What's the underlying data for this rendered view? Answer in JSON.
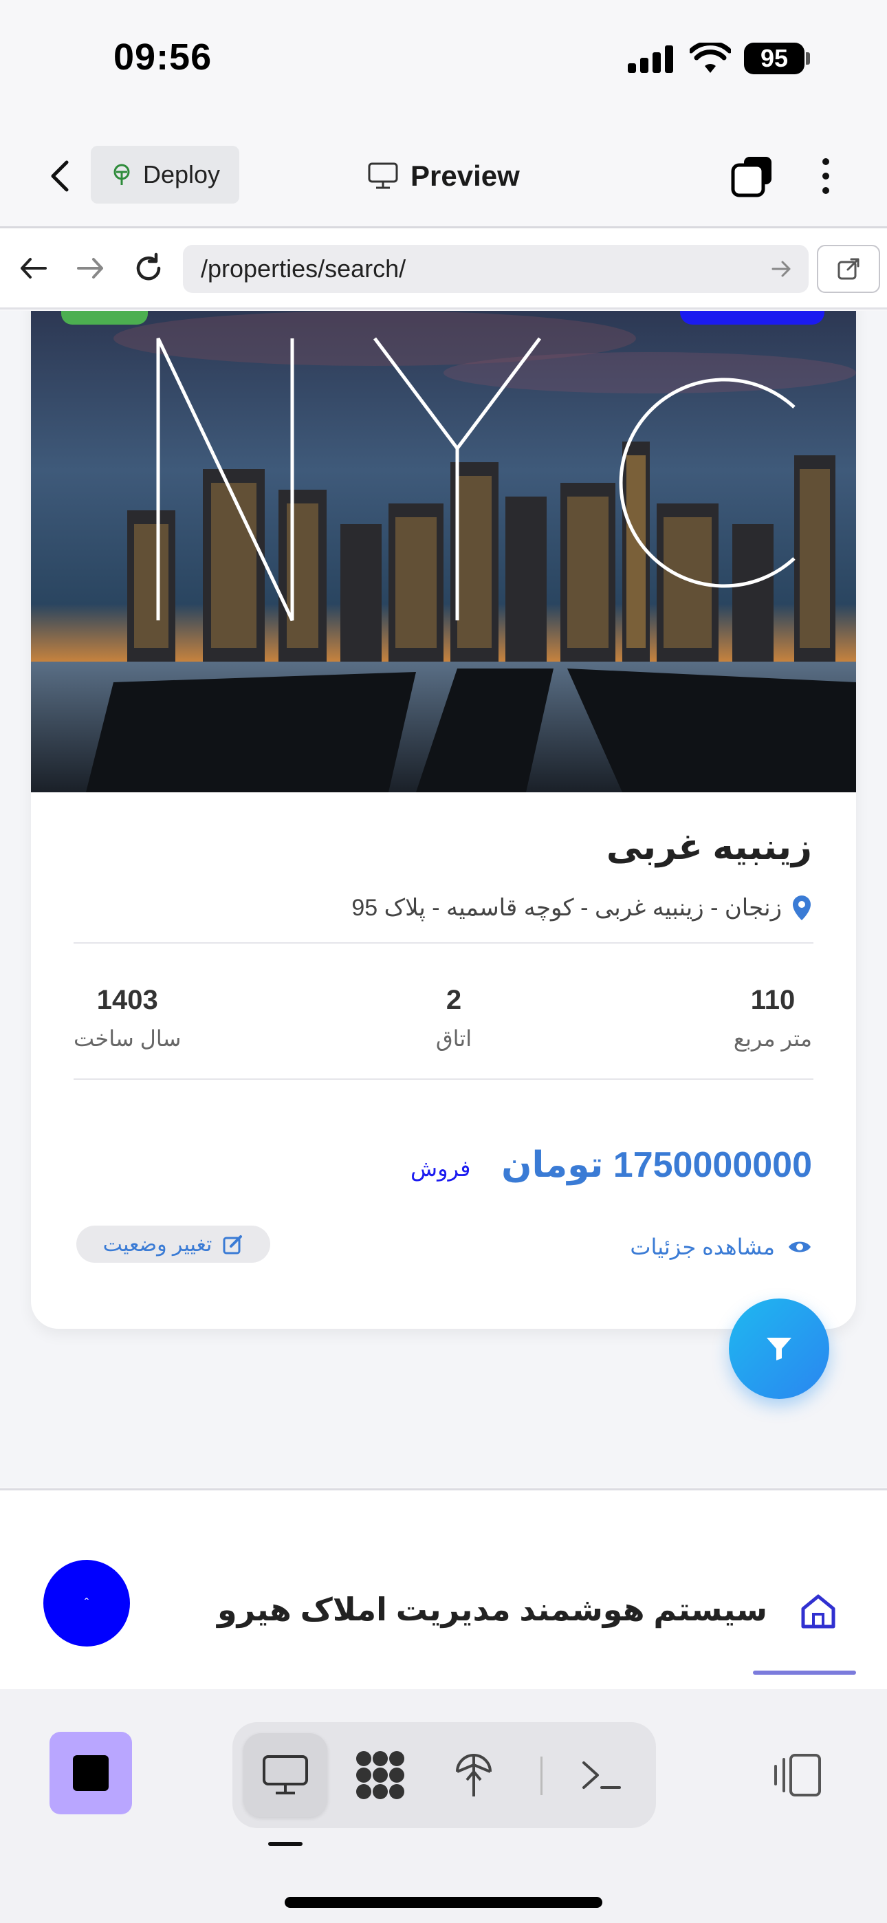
{
  "status_bar": {
    "time": "09:56",
    "battery": "95"
  },
  "topbar": {
    "deploy_label": "Deploy",
    "preview_label": "Preview"
  },
  "browser": {
    "url": "/properties/search/"
  },
  "property": {
    "photo_caption": "NYC",
    "title": "زینبیه غربی",
    "address": "زنجان - زینبیه غربی - کوچه قاسمیه - پلاک 95",
    "stats": [
      {
        "value": "110",
        "label": "متر مربع"
      },
      {
        "value": "2",
        "label": "اتاق"
      },
      {
        "value": "1403",
        "label": "سال ساخت"
      }
    ],
    "price": "1750000000 تومان",
    "deal_type": "فروش",
    "details_label": "مشاهده جزئیات",
    "change_status_label": "تغییر وضعیت"
  },
  "footer": {
    "scroll_top_glyph": "ˆ",
    "app_title": "سیستم هوشمند مدیریت املاک هیرو"
  },
  "colors": {
    "accent": "#3a7bd5",
    "brand_blue": "#1b1bf0",
    "stop_purple": "#b9a6ff"
  }
}
